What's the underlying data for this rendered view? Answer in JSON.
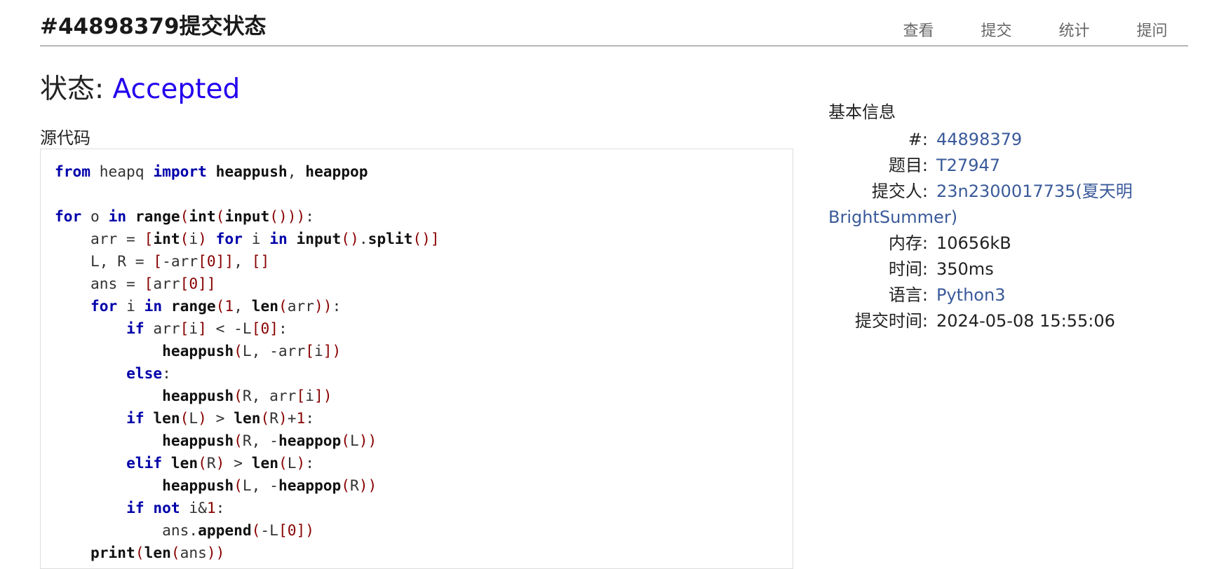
{
  "header": {
    "title": "#44898379提交状态",
    "nav": [
      "查看",
      "提交",
      "统计",
      "提问"
    ]
  },
  "status": {
    "label": "状态:",
    "value": "Accepted",
    "value_color": "#2200ee"
  },
  "source": {
    "label": "源代码",
    "lines": [
      "from heapq import heappush, heappop",
      "",
      "for o in range(int(input())):",
      "    arr = [int(i) for i in input().split()]",
      "    L, R = [-arr[0]], []",
      "    ans = [arr[0]]",
      "    for i in range(1, len(arr)):",
      "        if arr[i] < -L[0]:",
      "            heappush(L, -arr[i])",
      "        else:",
      "            heappush(R, arr[i])",
      "        if len(L) > len(R)+1:",
      "            heappush(R, -heappop(L))",
      "        elif len(R) > len(L):",
      "            heappush(L, -heappop(R))",
      "        if not i&1:",
      "            ans.append(-L[0])",
      "    print(len(ans))"
    ]
  },
  "info": {
    "title": "基本信息",
    "id_label": "#:",
    "id": "44898379",
    "problem_label": "题目:",
    "problem": "T27947",
    "submitter_label": "提交人:",
    "submitter_line1": "23n2300017735(夏天明",
    "submitter_line2": "BrightSummer)",
    "memory_label": "内存:",
    "memory": "10656kB",
    "time_label": "时间:",
    "time": "350ms",
    "language_label": "语言:",
    "language": "Python3",
    "submit_time_label": "提交时间:",
    "submit_time": "2024-05-08 15:55:06",
    "link_color": "#3a5a9a"
  }
}
